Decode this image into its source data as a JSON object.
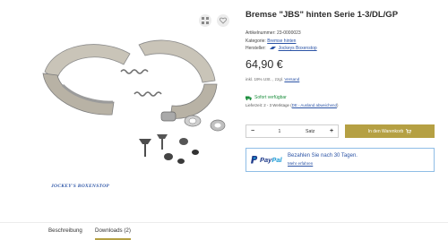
{
  "product": {
    "title": "Bremse \"JBS\" hinten Serie 1-3/DL/GP",
    "article_label": "Artikelnummer:",
    "article_number": "23-0000023",
    "category_label": "Kategorie:",
    "category": "Bremse hinten",
    "manufacturer_label": "Hersteller:",
    "manufacturer": "Jockeys Boxenstop",
    "price": "64,90 €",
    "tax_prefix": "inkl. 19% USt. , zzgl.",
    "tax_link": "Versand",
    "availability": "Sofort verfügbar",
    "delivery_prefix": "Lieferzeit: 2 - 3 Werktage (",
    "delivery_link": "DE - Ausland abweichend",
    "delivery_suffix": ")"
  },
  "gallery": {
    "brand_logo": "JOCKEY'S BOXENSTOP"
  },
  "purchase": {
    "quantity": "1",
    "unit": "Satz",
    "cart_label": "In den Warenkorb"
  },
  "paypal": {
    "logo_pay": "Pay",
    "logo_pal": "Pal",
    "message": "Bezahlen Sie nach 30 Tagen.",
    "more": "Mehr erfahren"
  },
  "tabs": [
    {
      "label": "Beschreibung"
    },
    {
      "label": "Downloads (2)"
    }
  ],
  "colors": {
    "accent": "#b5a043",
    "link": "#2c54a6",
    "available": "#1d8f3e"
  }
}
